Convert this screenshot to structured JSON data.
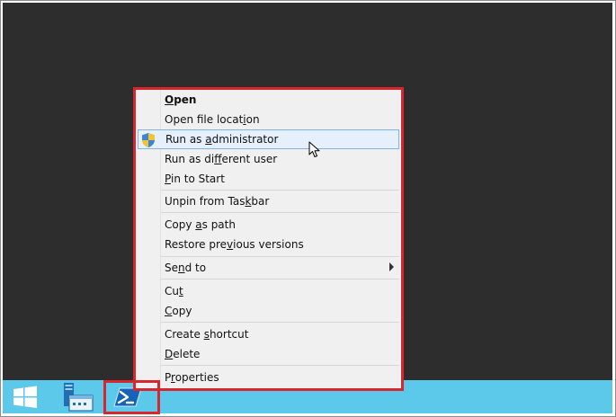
{
  "colors": {
    "desktop": "#2d2d2d",
    "taskbar": "#5dc9ea",
    "menu_bg": "#f0f0f0",
    "highlight": "#d8262f",
    "selected_bg": "#e6f0fa",
    "selected_border": "#7eb4ea"
  },
  "taskbar": {
    "items": [
      {
        "icon": "windows-start-icon"
      },
      {
        "icon": "server-manager-icon"
      },
      {
        "icon": "powershell-icon"
      }
    ]
  },
  "context_menu": {
    "items": [
      {
        "label_pre": "",
        "label_u": "O",
        "label_post": "pen",
        "bold": true
      },
      {
        "label_pre": "Open file locat",
        "label_u": "i",
        "label_post": "on"
      },
      {
        "label_pre": "Run as ",
        "label_u": "a",
        "label_post": "dministrator",
        "icon": "uac-shield-icon",
        "selected": true
      },
      {
        "label_pre": "Run as di",
        "label_u": "f",
        "label_post": "ferent user"
      },
      {
        "label_pre": "",
        "label_u": "P",
        "label_post": "in to Start"
      },
      {
        "label_pre": "Unpin from Tas",
        "label_u": "k",
        "label_post": "bar"
      },
      {
        "label_pre": "Copy ",
        "label_u": "a",
        "label_post": "s path"
      },
      {
        "label_pre": "Restore pre",
        "label_u": "v",
        "label_post": "ious versions"
      },
      {
        "label_pre": "Se",
        "label_u": "n",
        "label_post": "d to",
        "submenu": true
      },
      {
        "label_pre": "Cu",
        "label_u": "t",
        "label_post": ""
      },
      {
        "label_pre": "",
        "label_u": "C",
        "label_post": "opy"
      },
      {
        "label_pre": "Create ",
        "label_u": "s",
        "label_post": "hortcut"
      },
      {
        "label_pre": "",
        "label_u": "D",
        "label_post": "elete"
      },
      {
        "label_pre": "P",
        "label_u": "r",
        "label_post": "operties"
      }
    ]
  }
}
